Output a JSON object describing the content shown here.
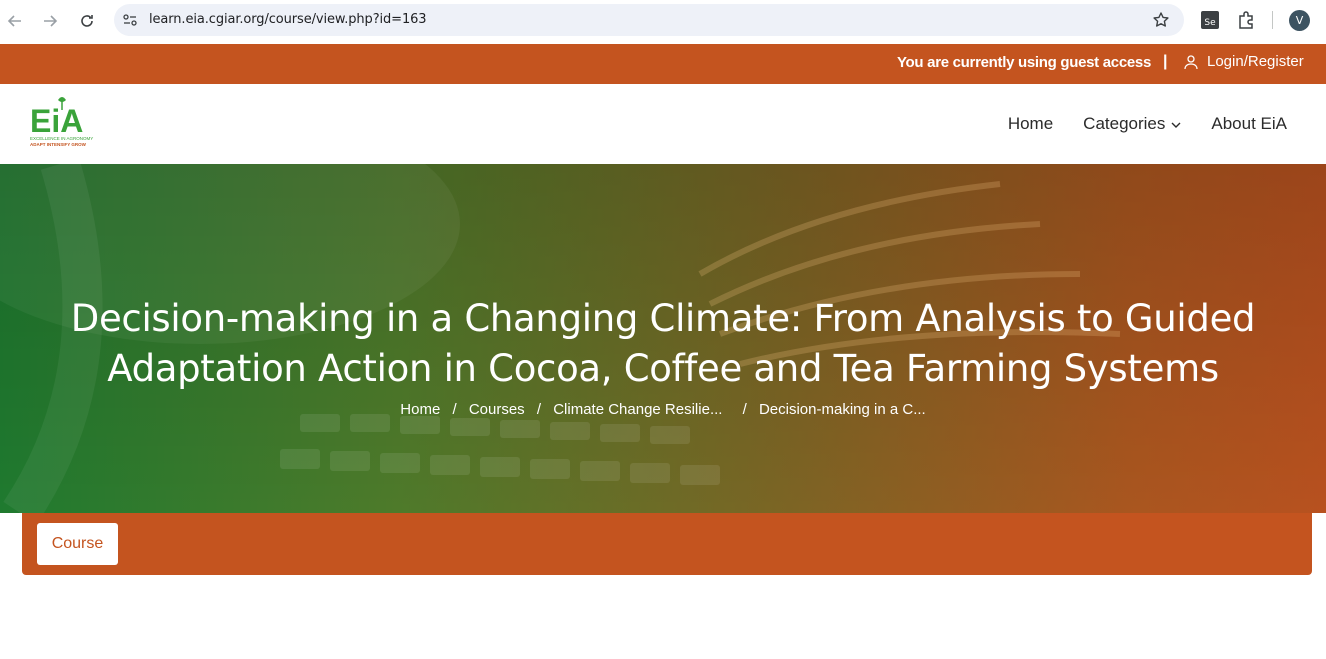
{
  "browser": {
    "url": "learn.eia.cgiar.org/course/view.php?id=163",
    "profile_initial": "V",
    "ext_label": "Se"
  },
  "guest_bar": {
    "guest_text": "You are currently using guest access",
    "separator": "|",
    "login_label": "Login/Register"
  },
  "header": {
    "logo_text": "EiA",
    "logo_tagline1": "EXCELLENCE IN AGRONOMY",
    "logo_tagline2": "ADAPT INTENSIFY GROW",
    "menu": {
      "home": "Home",
      "categories": "Categories",
      "about": "About EiA"
    }
  },
  "hero": {
    "title_line1": "Decision-making in a Changing Climate: From Analysis to Guided",
    "title_line2": "Adaptation Action in Cocoa, Coffee and Tea Farming Systems",
    "breadcrumb": {
      "home": "Home",
      "courses": "Courses",
      "category": "Climate Change Resilie...",
      "current": "Decision-making in a C...",
      "sep": "/"
    }
  },
  "secondary_nav": {
    "course_tab": "Course"
  },
  "colors": {
    "brand_orange": "#c4541f",
    "brand_green": "#1f7a2f"
  }
}
